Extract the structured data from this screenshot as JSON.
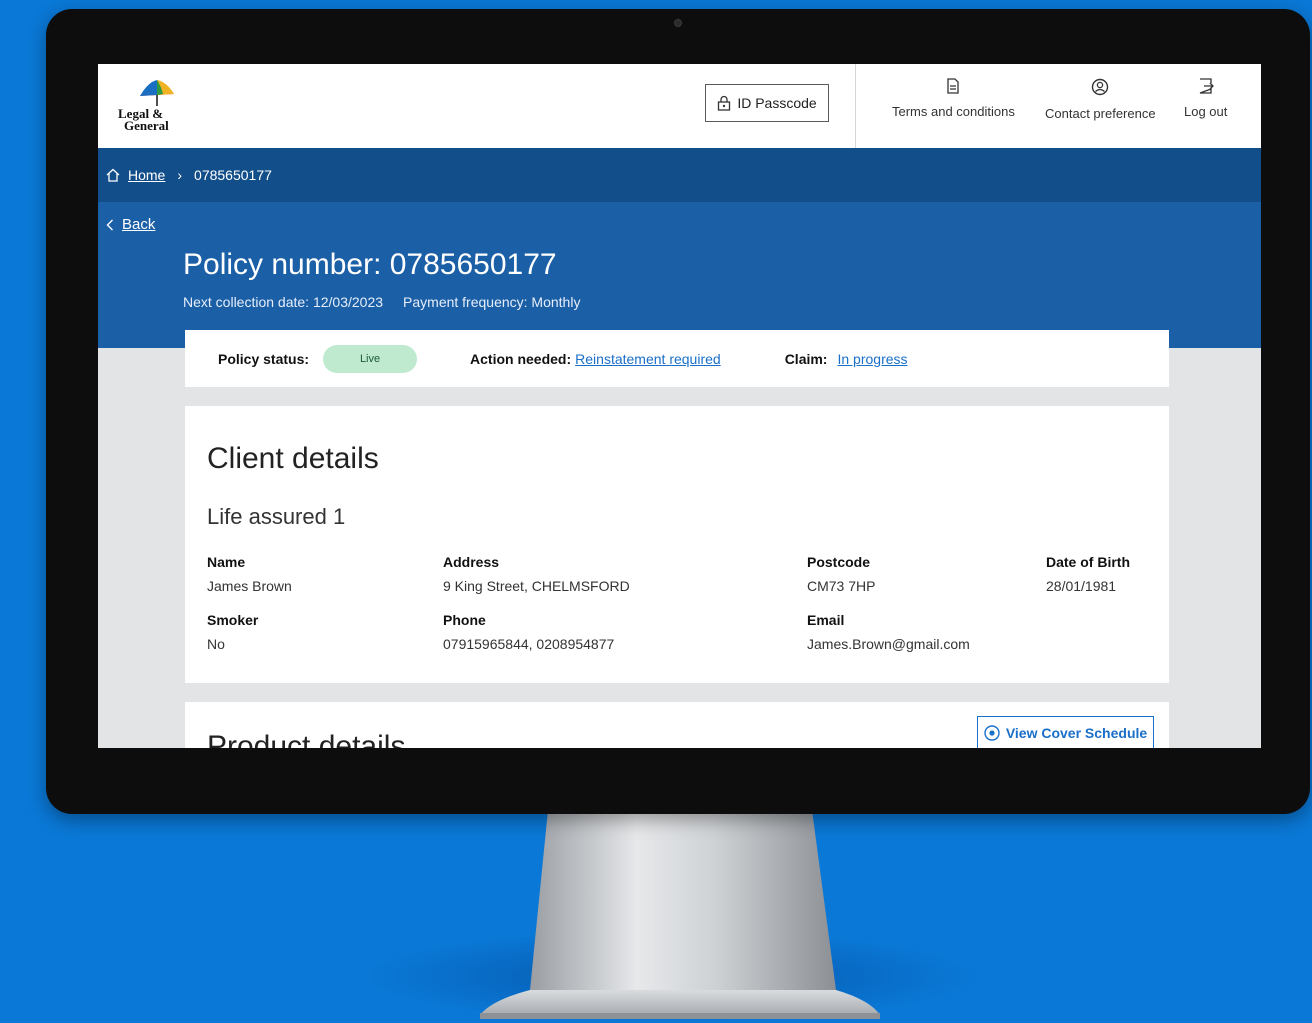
{
  "brand": {
    "logo_line1": "Legal &",
    "logo_line2": "General"
  },
  "header": {
    "id_passcode_label": "ID Passcode",
    "links": [
      {
        "label": "Terms and conditions",
        "icon": "document-icon"
      },
      {
        "label": "Contact preference",
        "icon": "user-circle-icon"
      },
      {
        "label": "Log out",
        "icon": "logout-icon"
      }
    ]
  },
  "breadcrumb": {
    "home_label": "Home",
    "separator": "›",
    "current": "0785650177"
  },
  "hero": {
    "back_label": "Back",
    "title": "Policy number: 0785650177",
    "next_collection": "Next collection date: 12/03/2023",
    "payment_frequency": "Payment frequency: Monthly"
  },
  "status": {
    "policy_status_label": "Policy status:",
    "policy_status_value": "Live",
    "action_label": "Action needed:",
    "action_value": "Reinstatement required",
    "claim_label": "Claim:",
    "claim_value": "In progress"
  },
  "client": {
    "title": "Client details",
    "subtitle": "Life assured 1",
    "fields": {
      "name_label": "Name",
      "name": "James Brown",
      "address_label": "Address",
      "address": "9 King Street, CHELMSFORD",
      "postcode_label": "Postcode",
      "postcode": "CM73 7HP",
      "dob_label": "Date of Birth",
      "dob": "28/01/1981",
      "smoker_label": "Smoker",
      "smoker": "No",
      "phone_label": "Phone",
      "phone": "07915965844, 0208954877",
      "email_label": "Email",
      "email": "James.Brown@gmail.com"
    }
  },
  "product": {
    "title": "Product details",
    "cover_button": "View Cover Schedule"
  },
  "colors": {
    "background": "#0a78d6",
    "breadcrumb_bar": "#124f8a",
    "hero": "#1b5fa6",
    "status_live": "#bfead0",
    "link": "#1a6fc9"
  }
}
